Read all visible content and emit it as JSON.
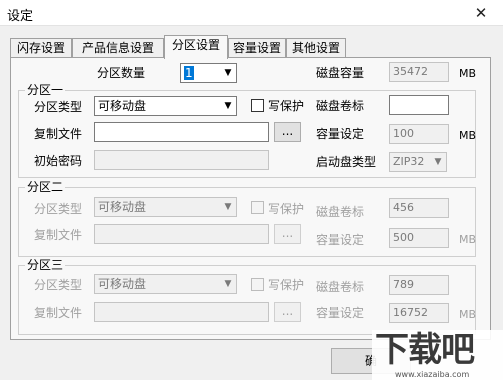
{
  "window": {
    "title": "设定",
    "close_glyph": "✕"
  },
  "tabs": [
    {
      "label": "闪存设置"
    },
    {
      "label": "产品信息设置"
    },
    {
      "label": "分区设置"
    },
    {
      "label": "容量设置"
    },
    {
      "label": "其他设置"
    }
  ],
  "header": {
    "partition_count_label": "分区数量",
    "partition_count_value": "1",
    "disk_capacity_label": "磁盘容量",
    "disk_capacity_value": "35472",
    "unit": "MB"
  },
  "partition1": {
    "legend": "分区一",
    "type_label": "分区类型",
    "type_value": "可移动盘",
    "write_protect_label": "写保护",
    "volume_label_label": "磁盘卷标",
    "volume_label_value": "",
    "copy_file_label": "复制文件",
    "copy_file_value": "",
    "browse_label": "...",
    "capacity_label": "容量设定",
    "capacity_value": "100",
    "capacity_unit": "MB",
    "init_password_label": "初始密码",
    "init_password_value": "",
    "boot_type_label": "启动盘类型",
    "boot_type_value": "ZIP32"
  },
  "partition2": {
    "legend": "分区二",
    "type_label": "分区类型",
    "type_value": "可移动盘",
    "write_protect_label": "写保护",
    "volume_label_label": "磁盘卷标",
    "volume_label_value": "456",
    "copy_file_label": "复制文件",
    "browse_label": "...",
    "capacity_label": "容量设定",
    "capacity_value": "500",
    "capacity_unit": "MB"
  },
  "partition3": {
    "legend": "分区三",
    "type_label": "分区类型",
    "type_value": "可移动盘",
    "write_protect_label": "写保护",
    "volume_label_label": "磁盘卷标",
    "volume_label_value": "789",
    "copy_file_label": "复制文件",
    "browse_label": "...",
    "capacity_label": "容量设定",
    "capacity_value": "16752",
    "capacity_unit": "MB"
  },
  "footer": {
    "ok_label": "确"
  },
  "watermark": {
    "logo_text": "下载吧",
    "url_text": "www.xiazaiba.com"
  }
}
